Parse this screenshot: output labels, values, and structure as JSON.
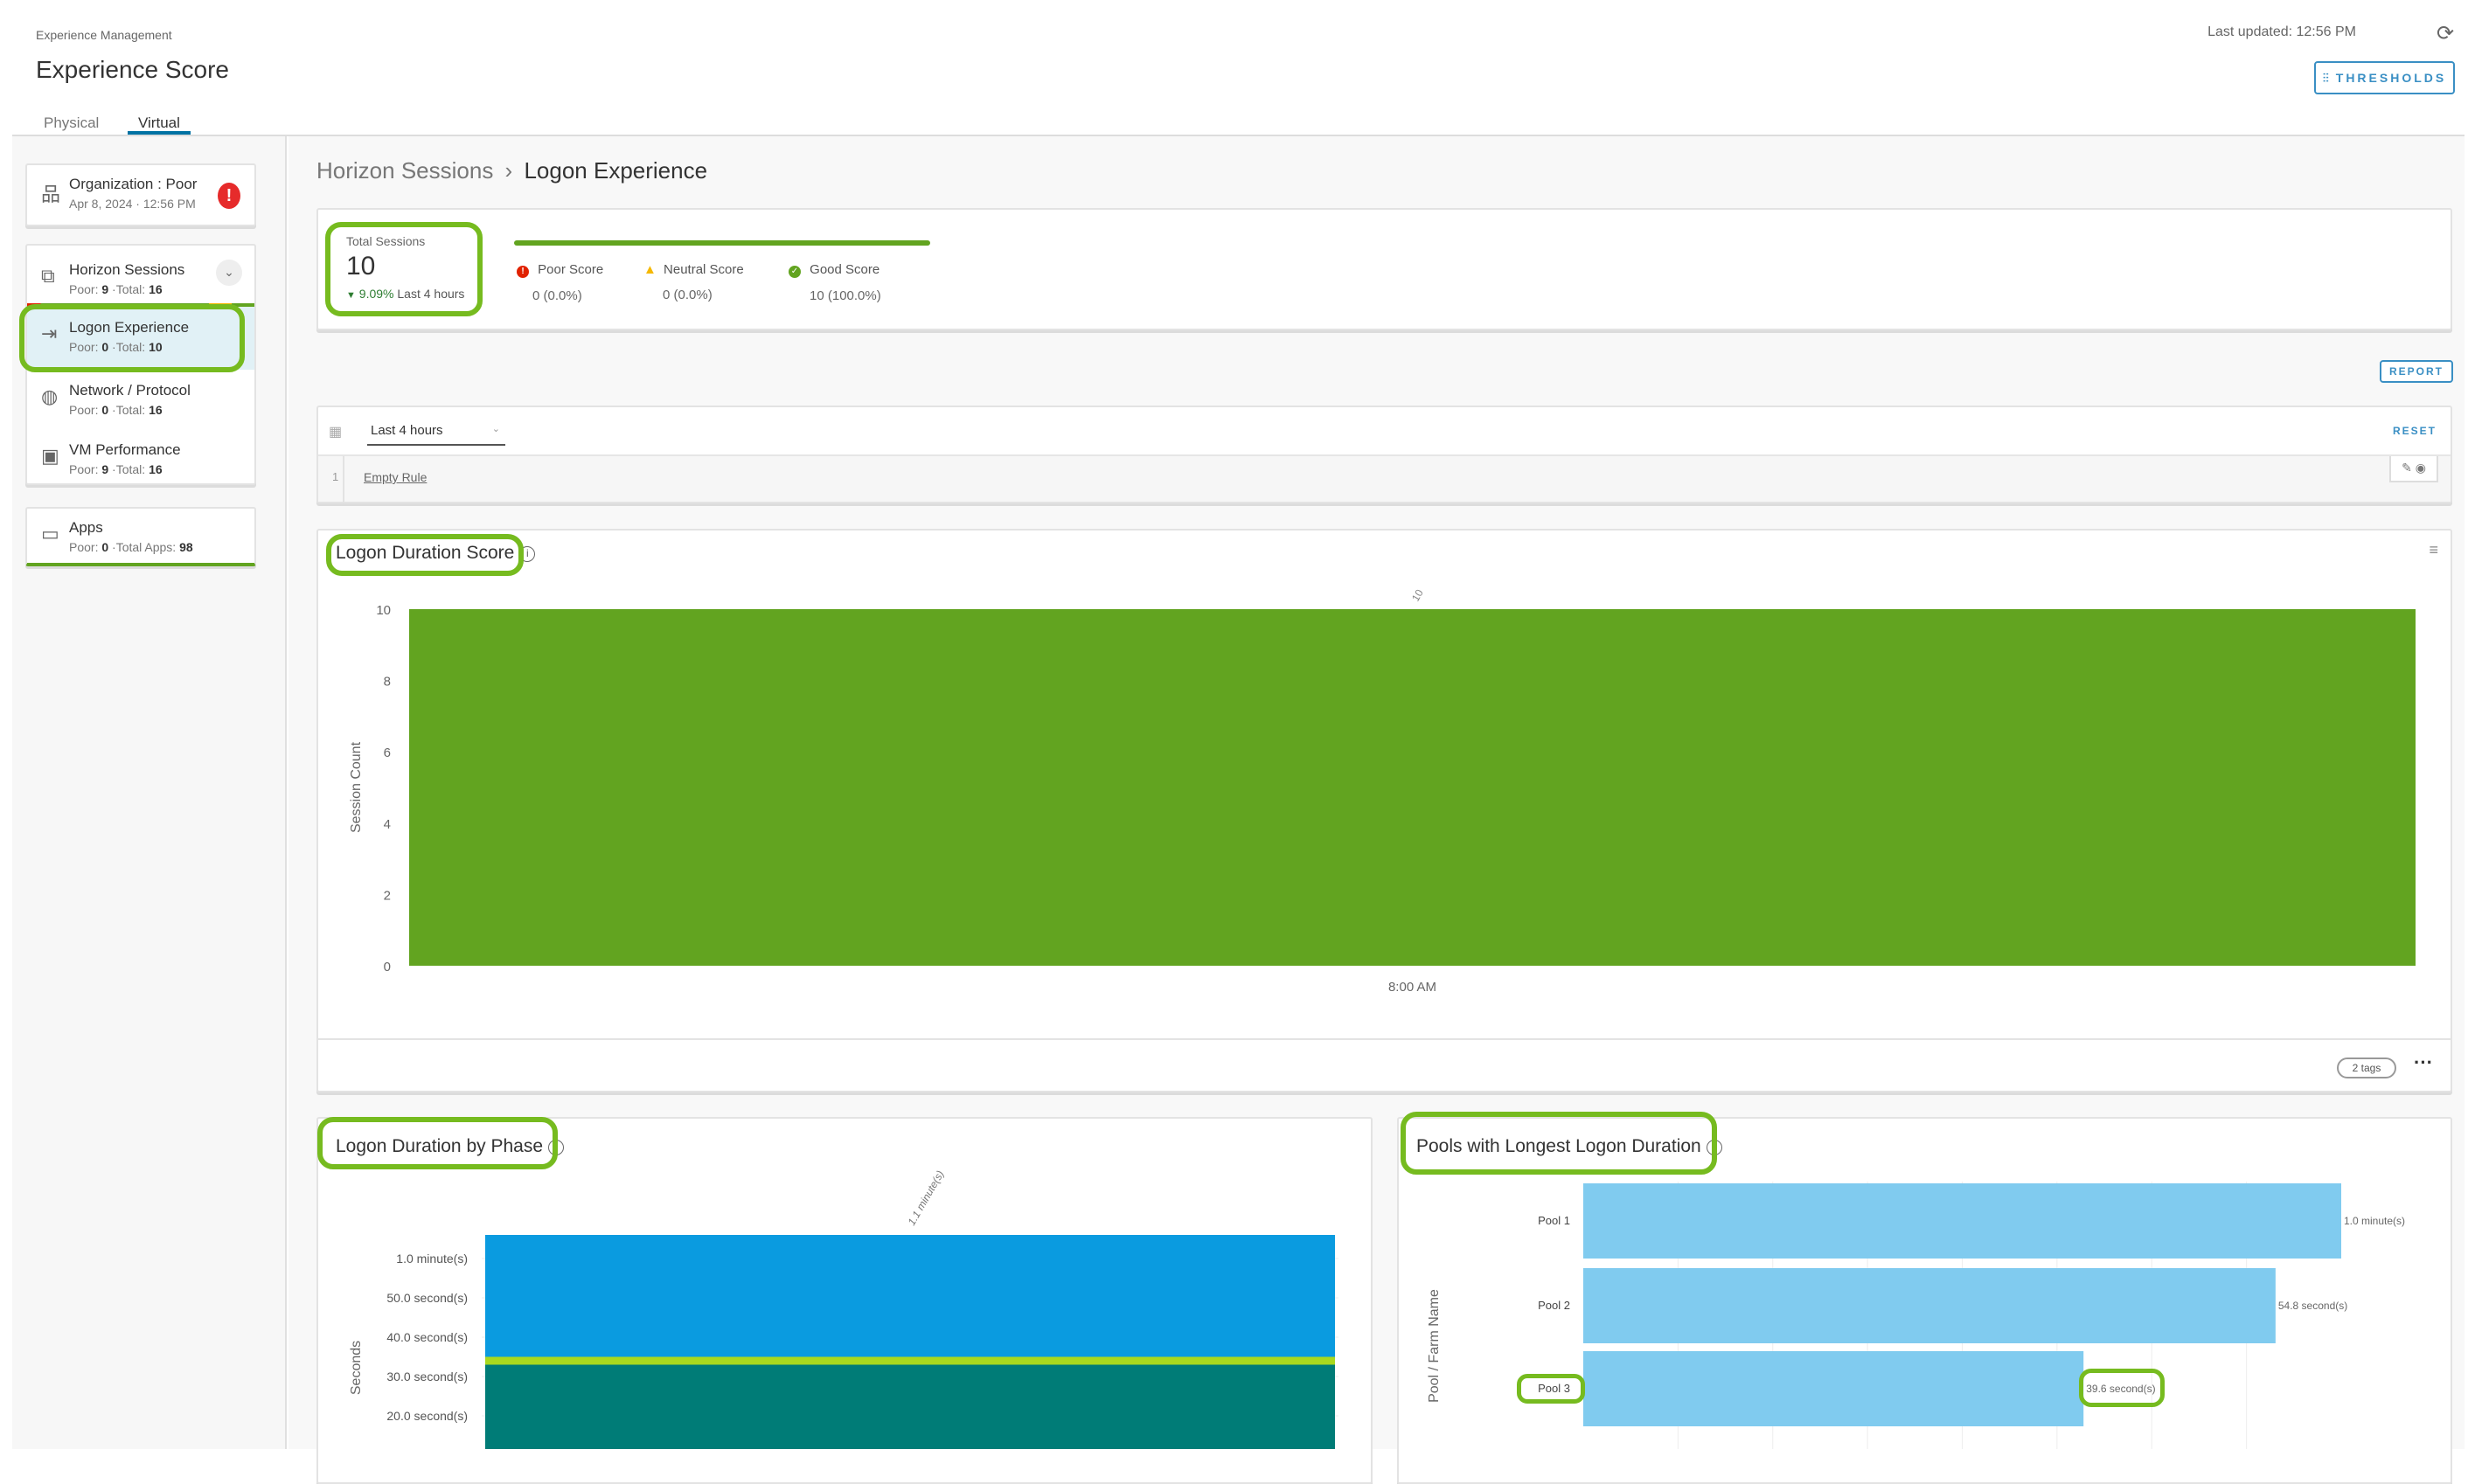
{
  "header": {
    "section": "Experience Management",
    "title": "Experience Score",
    "tabs": [
      {
        "label": "Physical"
      },
      {
        "label": "Virtual",
        "active": true
      }
    ],
    "last_updated": "Last updated: 12:56 PM",
    "thresholds_label": "THRESHOLDS"
  },
  "sidebar": {
    "org": {
      "title": "Organization : Poor",
      "subtitle": "Apr 8, 2024 · 12:56 PM",
      "status_icon": "alert-circle-icon"
    },
    "horizon": {
      "title": "Horizon Sessions",
      "poor_label": "Poor:",
      "poor": "9",
      "total_label": "·Total:",
      "total": "16"
    },
    "items": [
      {
        "title": "Logon Experience",
        "poor_label": "Poor:",
        "poor": "0",
        "total_label": "·Total:",
        "total": "10",
        "active": true
      },
      {
        "title": "Network / Protocol",
        "poor_label": "Poor:",
        "poor": "0",
        "total_label": "·Total:",
        "total": "16"
      },
      {
        "title": "VM Performance",
        "poor_label": "Poor:",
        "poor": "9",
        "total_label": "·Total:",
        "total": "16"
      }
    ],
    "apps": {
      "title": "Apps",
      "poor_label": "Poor:",
      "poor": "0",
      "total_label": "·Total Apps:",
      "total": "98"
    }
  },
  "breadcrumb": {
    "parent": "Horizon Sessions",
    "separator": "›",
    "current": "Logon Experience"
  },
  "summary": {
    "total_label": "Total Sessions",
    "total": "10",
    "change": "9.09%",
    "period": "Last 4 hours",
    "scores": [
      {
        "label": "Poor Score",
        "value": "0 (0.0%)",
        "color": "#e12200"
      },
      {
        "label": "Neutral Score",
        "value": "0 (0.0%)",
        "color": "#f5b800"
      },
      {
        "label": "Good Score",
        "value": "10 (100.0%)",
        "color": "#62a420"
      }
    ]
  },
  "report_label": "REPORT",
  "filter": {
    "time_range": "Last 4 hours",
    "reset_label": "RESET",
    "rule_index": "1",
    "rule": "Empty Rule"
  },
  "score_chart": {
    "title": "Logon Duration Score",
    "footer_tags": "2 tags"
  },
  "phase_chart": {
    "title": "Logon Duration by Phase"
  },
  "pools_chart": {
    "title": "Pools with Longest Logon Duration"
  },
  "chart_data": [
    {
      "type": "bar",
      "title": "Logon Duration Score",
      "categories": [
        "8:00 AM"
      ],
      "values": [
        10
      ],
      "data_labels": [
        "10"
      ],
      "ylabel": "Session Count",
      "ylim": [
        0,
        10
      ],
      "yticks": [
        "0",
        "2",
        "4",
        "6",
        "8",
        "10"
      ],
      "color": "#62a420"
    },
    {
      "type": "bar",
      "stacked": true,
      "title": "Logon Duration by Phase",
      "ylabel": "Seconds",
      "yticks": [
        {
          "value": 20,
          "label": "20.0 second(s)"
        },
        {
          "value": 30,
          "label": "30.0 second(s)"
        },
        {
          "value": 40,
          "label": "40.0 second(s)"
        },
        {
          "value": 50,
          "label": "50.0 second(s)"
        },
        {
          "value": 60,
          "label": "1.0 minute(s)"
        }
      ],
      "total_label": "1.1 minute(s)",
      "series": [
        {
          "values": [
            33
          ],
          "color": "#007c77"
        },
        {
          "values": [
            2
          ],
          "color": "#a9d91e"
        },
        {
          "values": [
            31
          ],
          "color": "#0a9be0"
        }
      ]
    },
    {
      "type": "bar",
      "orientation": "horizontal",
      "title": "Pools with Longest Logon Duration",
      "ylabel": "Pool / Farm Name",
      "categories": [
        "Pool 1",
        "Pool 2",
        "Pool 3"
      ],
      "values": [
        60,
        54.8,
        39.6
      ],
      "data_labels": [
        "1.0 minute(s)",
        "54.8 second(s)",
        "39.6 second(s)"
      ],
      "color": "#80cbef"
    }
  ]
}
